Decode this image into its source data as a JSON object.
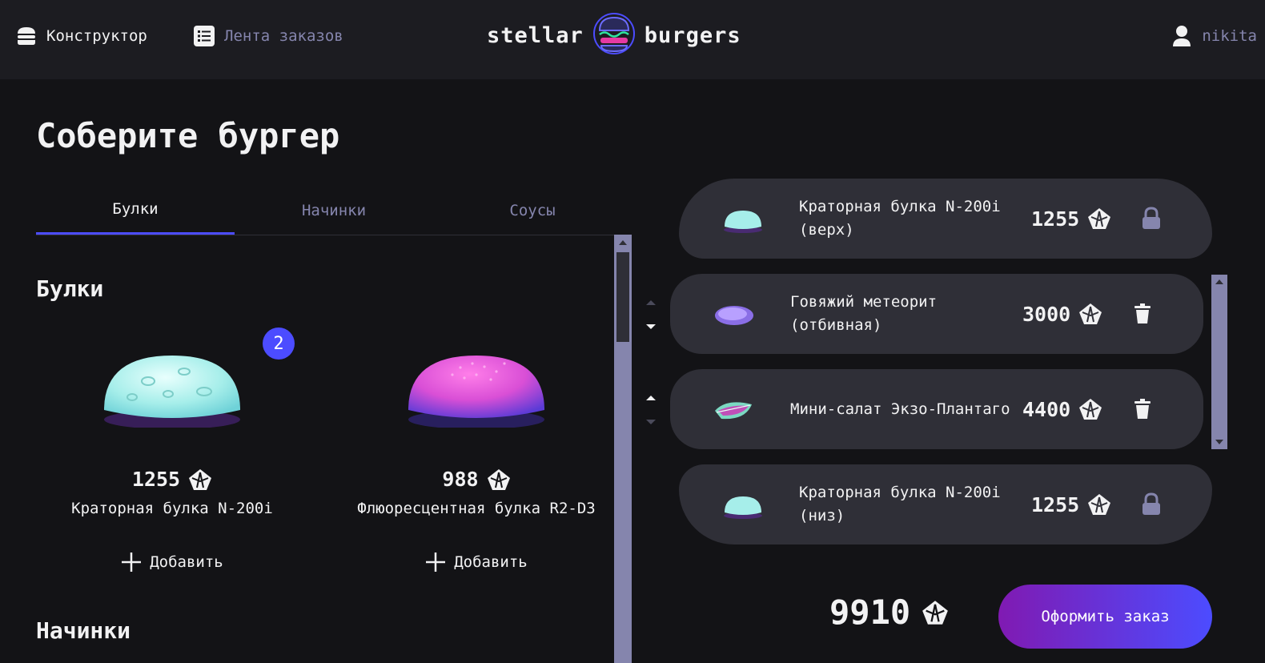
{
  "header": {
    "nav_constructor": "Конструктор",
    "nav_feed": "Лента заказов",
    "logo_left": "stellar",
    "logo_right": "burgers",
    "profile_name": "nikita"
  },
  "main": {
    "title": "Соберите бургер",
    "tabs": [
      {
        "label": "Булки",
        "active": true
      },
      {
        "label": "Начинки",
        "active": false
      },
      {
        "label": "Соусы",
        "active": false
      }
    ],
    "sections": {
      "buns_title": "Булки",
      "fillings_title": "Начинки"
    },
    "cards": [
      {
        "price": "1255",
        "name": "Краторная булка N-200i",
        "add_label": "Добавить",
        "count": "2",
        "color": "#b6f0ef"
      },
      {
        "price": "988",
        "name": "Флюоресцентная булка R2-D3",
        "add_label": "Добавить",
        "color": "#d94fd6"
      }
    ]
  },
  "constructor": {
    "top_bun": {
      "name": "Краторная булка N-200i (верх)",
      "price": "1255"
    },
    "fillings": [
      {
        "name": "Говяжий метеорит (отбивная)",
        "price": "3000"
      },
      {
        "name": "Мини-салат Экзо-Плантаго",
        "price": "4400"
      }
    ],
    "bottom_bun": {
      "name": "Краторная булка N-200i (низ)",
      "price": "1255"
    },
    "total": "9910",
    "order_button": "Оформить заказ"
  },
  "icons": [
    "burger-icon",
    "list-icon",
    "profile-icon",
    "currency-icon",
    "lock-icon",
    "delete-icon",
    "plus-icon",
    "drag-arrows-icon"
  ],
  "colors": {
    "accent": "#4c4cff",
    "muted": "#8585ad",
    "panel": "#2f2f37",
    "background": "#131316",
    "header": "#1c1c21"
  }
}
